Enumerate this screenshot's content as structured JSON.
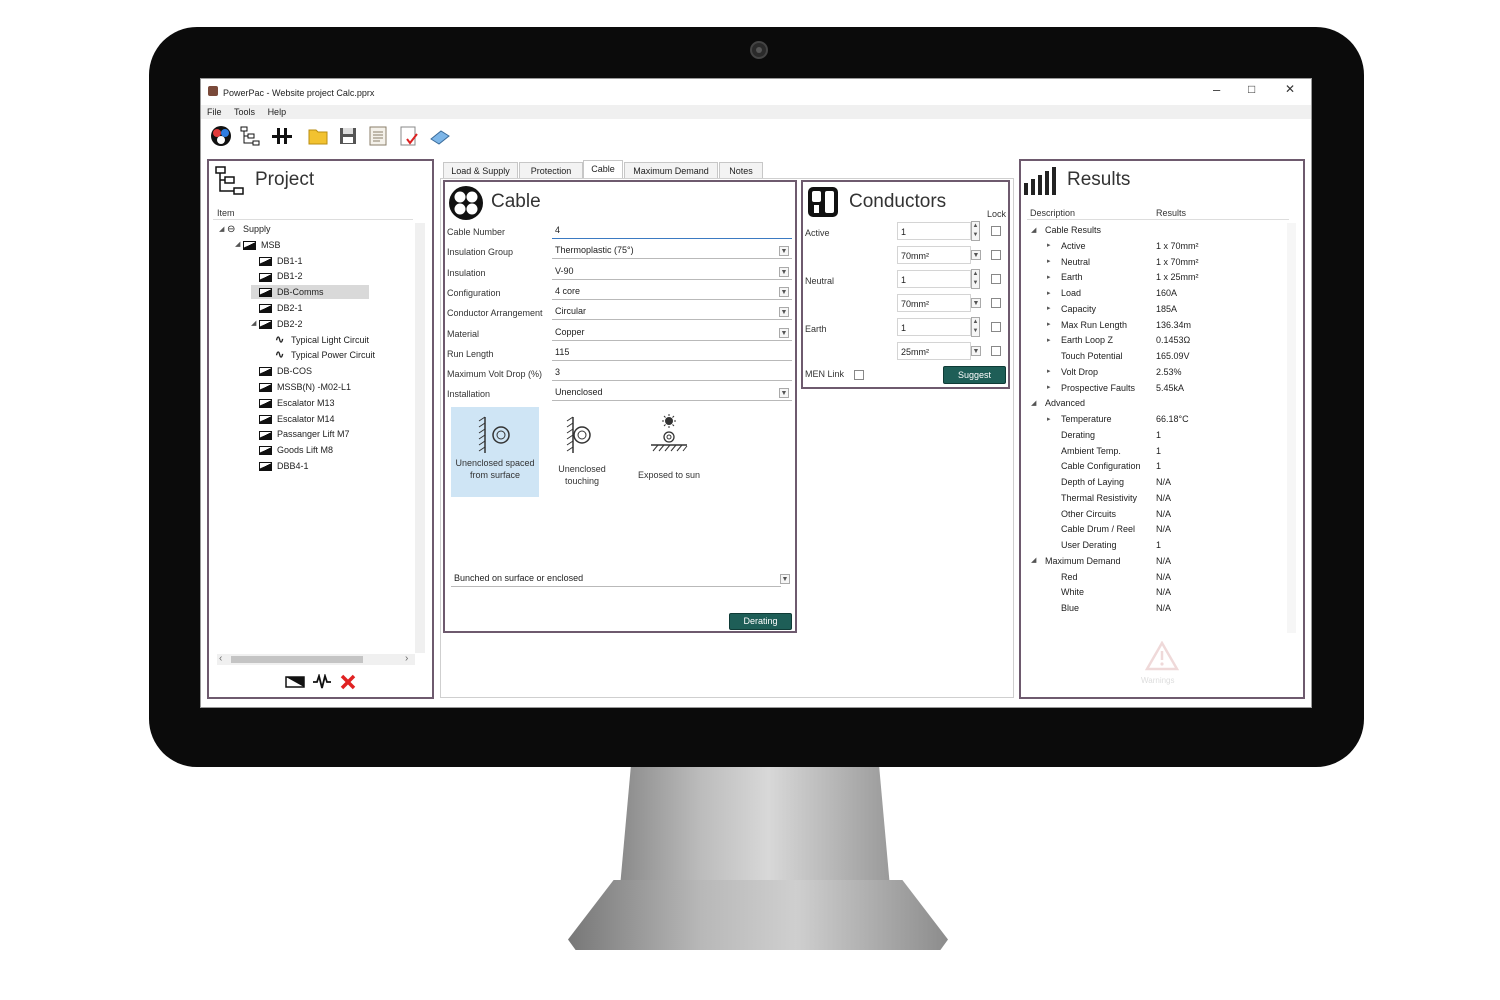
{
  "window": {
    "title": "PowerPac - Website project Calc.pprx",
    "minimize": "–",
    "maximize": "□",
    "close": "✕"
  },
  "menu": [
    "File",
    "Tools",
    "Help"
  ],
  "toolbar_icons": [
    "mode-icon",
    "tree-icon",
    "busbar-icon",
    "open-folder-icon",
    "save-icon",
    "report-icon",
    "check-document-icon",
    "calculator-icon"
  ],
  "project": {
    "title": "Project",
    "column": "Item",
    "tree": [
      {
        "label": "Supply",
        "level": 0,
        "arrow": "◢",
        "icon": "supply"
      },
      {
        "label": "MSB",
        "level": 1,
        "arrow": "◢",
        "icon": "board"
      },
      {
        "label": "DB1-1",
        "level": 2,
        "icon": "board"
      },
      {
        "label": "DB1-2",
        "level": 2,
        "icon": "board"
      },
      {
        "label": "DB-Comms",
        "level": 2,
        "icon": "board",
        "selected": true
      },
      {
        "label": "DB2-1",
        "level": 2,
        "icon": "board"
      },
      {
        "label": "DB2-2",
        "level": 2,
        "arrow": "◢",
        "icon": "board"
      },
      {
        "label": "Typical Light Circuit",
        "level": 3,
        "icon": "circuit"
      },
      {
        "label": "Typical Power Circuit",
        "level": 3,
        "icon": "circuit"
      },
      {
        "label": "DB-COS",
        "level": 2,
        "icon": "board"
      },
      {
        "label": "MSSB(N) -M02-L1",
        "level": 2,
        "icon": "board"
      },
      {
        "label": "Escalator M13",
        "level": 2,
        "icon": "board"
      },
      {
        "label": "Escalator M14",
        "level": 2,
        "icon": "board"
      },
      {
        "label": "Passanger Lift M7",
        "level": 2,
        "icon": "board"
      },
      {
        "label": "Goods Lift M8",
        "level": 2,
        "icon": "board"
      },
      {
        "label": "DBB4-1",
        "level": 2,
        "icon": "board"
      }
    ],
    "scroll_left": "‹",
    "scroll_right": "›"
  },
  "tabs": [
    "Load & Supply",
    "Protection",
    "Cable",
    "Maximum Demand",
    "Notes"
  ],
  "active_tab": "Cable",
  "cable": {
    "title": "Cable",
    "fields": [
      {
        "label": "Cable Number",
        "value": "4",
        "dropdown": false
      },
      {
        "label": "Insulation Group",
        "value": "Thermoplastic (75°)",
        "dropdown": true
      },
      {
        "label": "Insulation",
        "value": "V-90",
        "dropdown": true
      },
      {
        "label": "Configuration",
        "value": "4 core",
        "dropdown": true
      },
      {
        "label": "Conductor Arrangement",
        "value": "Circular",
        "dropdown": true
      },
      {
        "label": "Material",
        "value": "Copper",
        "dropdown": true
      },
      {
        "label": "Run Length",
        "value": "115",
        "dropdown": false
      },
      {
        "label": "Maximum Volt Drop (%)",
        "value": "3",
        "dropdown": false
      },
      {
        "label": "Installation",
        "value": "Unenclosed",
        "dropdown": true
      }
    ],
    "options": [
      {
        "label": "Unenclosed spaced from surface",
        "selected": true
      },
      {
        "label": "Unenclosed touching",
        "selected": false
      },
      {
        "label": "Exposed to sun",
        "selected": false
      }
    ],
    "grouping": "Bunched on surface or enclosed",
    "derating_button": "Derating"
  },
  "conductors": {
    "title": "Conductors",
    "lock_label": "Lock",
    "rows": [
      {
        "label": "Active",
        "count": "1",
        "size": "70mm²"
      },
      {
        "label": "Neutral",
        "count": "1",
        "size": "70mm²"
      },
      {
        "label": "Earth",
        "count": "1",
        "size": "25mm²"
      }
    ],
    "men_link": "MEN Link",
    "suggest_button": "Suggest"
  },
  "results": {
    "title": "Results",
    "col_description": "Description",
    "col_results": "Results",
    "rows": [
      {
        "desc": "Cable Results",
        "value": "",
        "indent": 0,
        "arrow": "◢"
      },
      {
        "desc": "Active",
        "value": "1 x 70mm²",
        "indent": 1,
        "arrow": "▸"
      },
      {
        "desc": "Neutral",
        "value": "1 x 70mm²",
        "indent": 1,
        "arrow": "▸"
      },
      {
        "desc": "Earth",
        "value": "1 x 25mm²",
        "indent": 1,
        "arrow": "▸"
      },
      {
        "desc": "Load",
        "value": "160A",
        "indent": 1,
        "arrow": "▸"
      },
      {
        "desc": "Capacity",
        "value": "185A",
        "indent": 1,
        "arrow": "▸"
      },
      {
        "desc": "Max Run Length",
        "value": "136.34m",
        "indent": 1,
        "arrow": "▸"
      },
      {
        "desc": "Earth Loop Z",
        "value": "0.1453Ω",
        "indent": 1,
        "arrow": "▸"
      },
      {
        "desc": "Touch Potential",
        "value": "165.09V",
        "indent": 1,
        "arrow": ""
      },
      {
        "desc": "Volt Drop",
        "value": "2.53%",
        "indent": 1,
        "arrow": "▸"
      },
      {
        "desc": "Prospective Faults",
        "value": "5.45kA",
        "indent": 1,
        "arrow": "▸"
      },
      {
        "desc": "Advanced",
        "value": "",
        "indent": 0,
        "arrow": "◢"
      },
      {
        "desc": "Temperature",
        "value": "66.18°C",
        "indent": 1,
        "arrow": "▸"
      },
      {
        "desc": "Derating",
        "value": "1",
        "indent": 1,
        "arrow": ""
      },
      {
        "desc": "Ambient Temp.",
        "value": "1",
        "indent": 1,
        "arrow": ""
      },
      {
        "desc": "Cable Configuration",
        "value": "1",
        "indent": 1,
        "arrow": ""
      },
      {
        "desc": "Depth of Laying",
        "value": "N/A",
        "indent": 1,
        "arrow": ""
      },
      {
        "desc": "Thermal Resistivity",
        "value": "N/A",
        "indent": 1,
        "arrow": ""
      },
      {
        "desc": "Other Circuits",
        "value": "N/A",
        "indent": 1,
        "arrow": ""
      },
      {
        "desc": "Cable Drum / Reel",
        "value": "N/A",
        "indent": 1,
        "arrow": ""
      },
      {
        "desc": "User Derating",
        "value": "1",
        "indent": 1,
        "arrow": ""
      },
      {
        "desc": "Maximum Demand",
        "value": "N/A",
        "indent": 0,
        "arrow": "◢"
      },
      {
        "desc": "Red",
        "value": "N/A",
        "indent": 1,
        "arrow": ""
      },
      {
        "desc": "White",
        "value": "N/A",
        "indent": 1,
        "arrow": ""
      },
      {
        "desc": "Blue",
        "value": "N/A",
        "indent": 1,
        "arrow": ""
      }
    ],
    "warning_label": "Warnings"
  },
  "colors": {
    "accent_button": "#1e5e57",
    "panel_border": "#6e5a6e",
    "selected_option": "#cfe5f5",
    "selected_tree": "#d9d9d9"
  }
}
